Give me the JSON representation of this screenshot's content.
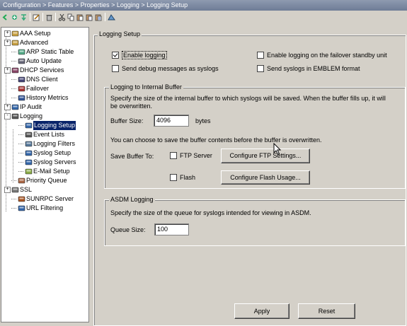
{
  "breadcrumb": "Configuration > Features > Properties > Logging > Logging Setup",
  "toolbar": {
    "icons": [
      "back-icon",
      "forward-icon",
      "pin-icon",
      "edit-icon",
      "delete-icon",
      "cut-icon",
      "copy-icon",
      "paste-icon",
      "paste-alt-icon",
      "paste-special-icon",
      "find-icon"
    ]
  },
  "tree": {
    "items": [
      {
        "label": "AAA Setup",
        "icon": "key-icon",
        "expander": "+"
      },
      {
        "label": "Advanced",
        "icon": "folder-icon",
        "expander": "+"
      },
      {
        "label": "ARP Static Table",
        "icon": "table-icon",
        "expander": ""
      },
      {
        "label": "Auto Update",
        "icon": "update-icon",
        "expander": ""
      },
      {
        "label": "DHCP Services",
        "icon": "dhcp-icon",
        "expander": "+"
      },
      {
        "label": "DNS Client",
        "icon": "dns-icon",
        "expander": ""
      },
      {
        "label": "Failover",
        "icon": "failover-icon",
        "expander": ""
      },
      {
        "label": "History Metrics",
        "icon": "chart-icon",
        "expander": ""
      },
      {
        "label": "IP Audit",
        "icon": "audit-icon",
        "expander": "+"
      },
      {
        "label": "Logging",
        "icon": "log-icon",
        "expander": "-"
      },
      {
        "label": "Logging Setup",
        "icon": "log-setup-icon",
        "expander": "",
        "selected": true
      },
      {
        "label": "Event Lists",
        "icon": "list-icon",
        "expander": ""
      },
      {
        "label": "Logging Filters",
        "icon": "filter-icon",
        "expander": ""
      },
      {
        "label": "Syslog Setup",
        "icon": "syslog-icon",
        "expander": ""
      },
      {
        "label": "Syslog Servers",
        "icon": "server-icon",
        "expander": ""
      },
      {
        "label": "E-Mail Setup",
        "icon": "email-icon",
        "expander": ""
      },
      {
        "label": "Priority Queue",
        "icon": "queue-icon",
        "expander": ""
      },
      {
        "label": "SSL",
        "icon": "ssl-icon",
        "expander": "+"
      },
      {
        "label": "SUNRPC Server",
        "icon": "rpc-icon",
        "expander": ""
      },
      {
        "label": "URL Filtering",
        "icon": "url-icon",
        "expander": ""
      }
    ]
  },
  "main": {
    "title": "Logging Setup",
    "enable_logging": {
      "label": "Enable logging",
      "checked": true
    },
    "enable_failover": {
      "label": "Enable logging on the failover standby unit",
      "checked": false
    },
    "send_debug": {
      "label": "Send debug messages as syslogs",
      "checked": false
    },
    "send_emblem": {
      "label": "Send syslogs in EMBLEM format",
      "checked": false
    },
    "buffer_group": {
      "title": "Logging to Internal Buffer",
      "description_line1": "Specify the size of the internal buffer to which syslogs will be saved. When the buffer fills up, it will",
      "description_line2": "be overwritten.",
      "buffer_size_label": "Buffer Size:",
      "buffer_size_value": "4096",
      "buffer_size_unit": "bytes",
      "save_note": "You can choose to save the buffer contents before the buffer is overwritten.",
      "save_label": "Save Buffer To:",
      "ftp_label": "FTP Server",
      "ftp_checked": false,
      "ftp_button": "Configure FTP Settings...",
      "flash_label": "Flash",
      "flash_checked": false,
      "flash_button": "Configure Flash Usage..."
    },
    "asdm_group": {
      "title": "ASDM Logging",
      "description": "Specify the size of the queue for syslogs intended for viewing in ASDM.",
      "queue_label": "Queue Size:",
      "queue_value": "100"
    },
    "apply_button": "Apply",
    "reset_button": "Reset"
  }
}
